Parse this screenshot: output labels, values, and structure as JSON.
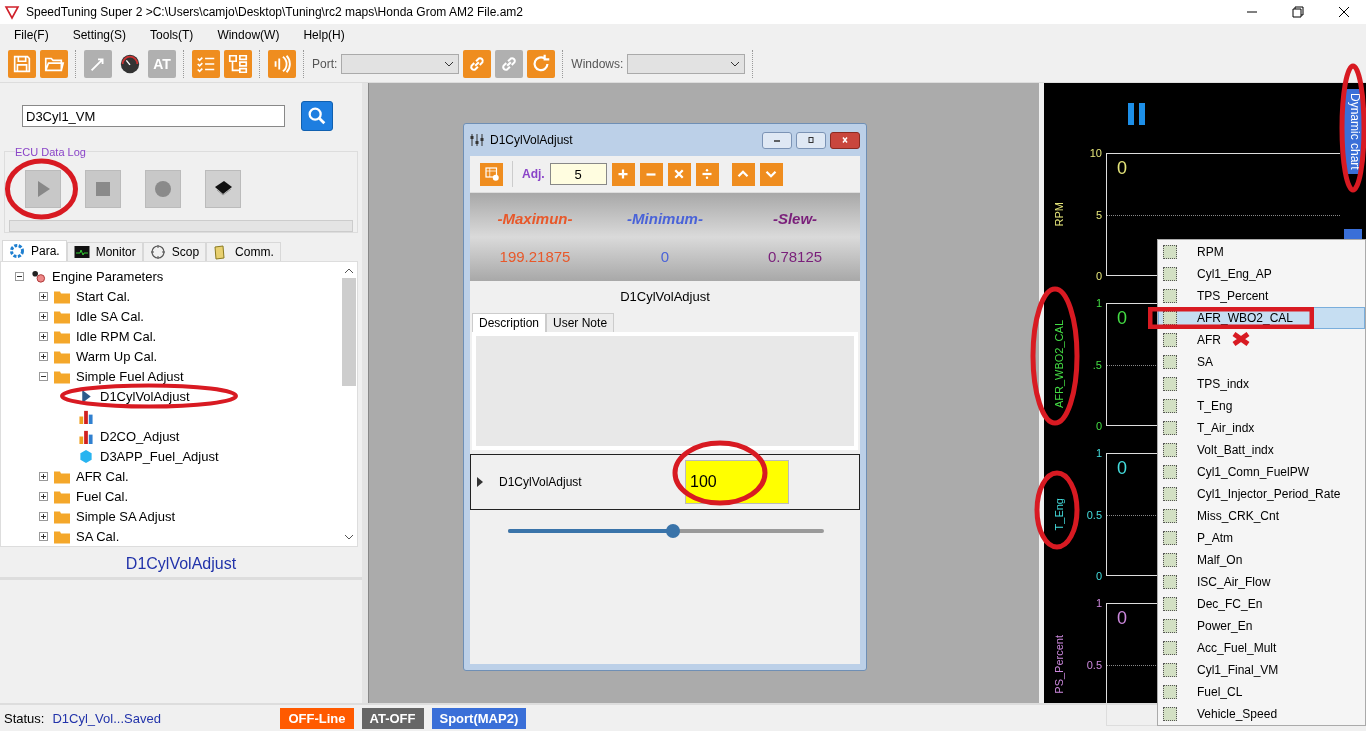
{
  "window": {
    "title": "SpeedTuning Super 2  >C:\\Users\\camjo\\Desktop\\Tuning\\rc2 maps\\Honda Grom AM2 File.am2"
  },
  "menu": [
    "File(F)",
    "Setting(S)",
    "Tools(T)",
    "Window(W)",
    "Help(H)"
  ],
  "toolbar": {
    "groups": [
      [
        {
          "kind": "save",
          "disabled": false
        },
        {
          "kind": "open",
          "disabled": false
        }
      ],
      [
        {
          "kind": "binary",
          "disabled": true
        },
        {
          "kind": "gauge",
          "disabled": false
        },
        {
          "kind": "text",
          "label": "AT",
          "disabled": true
        }
      ],
      [
        {
          "kind": "checklist",
          "disabled": false
        },
        {
          "kind": "tree",
          "disabled": false
        }
      ],
      [
        {
          "kind": "signal",
          "disabled": false
        }
      ]
    ],
    "port_label": "Port:",
    "conn": [
      {
        "kind": "link",
        "disabled": false
      },
      {
        "kind": "unlink",
        "disabled": true
      },
      {
        "kind": "refresh",
        "disabled": false
      }
    ],
    "windows_label": "Windows:"
  },
  "search": {
    "value": "D3Cyl1_VM"
  },
  "data_log": {
    "title": "ECU Data Log",
    "buttons": [
      {
        "kind": "play"
      },
      {
        "kind": "stop"
      },
      {
        "kind": "record"
      },
      {
        "kind": "chip"
      }
    ]
  },
  "tabs": [
    {
      "label": "Para.",
      "kind": "gear",
      "selected": true
    },
    {
      "label": "Monitor",
      "kind": "monitor",
      "selected": false
    },
    {
      "label": "Scop",
      "kind": "scope",
      "selected": false
    },
    {
      "label": "Comm.",
      "kind": "comm",
      "selected": false
    }
  ],
  "tree": {
    "label": "Engine Parameters",
    "expanded": true,
    "children": [
      {
        "label": "Start Cal.",
        "kind": "folder",
        "expanded": false
      },
      {
        "label": "Idle SA Cal.",
        "kind": "folder",
        "expanded": false
      },
      {
        "label": "Idle RPM Cal.",
        "kind": "folder",
        "expanded": false
      },
      {
        "label": "Warm Up Cal.",
        "kind": "folder",
        "expanded": false
      },
      {
        "label": "Simple Fuel Adjust",
        "kind": "folder",
        "expanded": true,
        "children": [
          {
            "label": "D1CylVolAdjust",
            "kind": "pointer"
          },
          {
            "kind": "bars"
          },
          {
            "label": "D2CO_Adjust",
            "kind": "bars"
          },
          {
            "label": "D3APP_Fuel_Adjust",
            "kind": "cube"
          }
        ]
      },
      {
        "label": "AFR Cal.",
        "kind": "folder",
        "expanded": false
      },
      {
        "label": "Fuel Cal.",
        "kind": "folder",
        "expanded": false
      },
      {
        "label": "Simple SA Adjust",
        "kind": "folder",
        "expanded": false
      },
      {
        "label": "SA Cal.",
        "kind": "folder",
        "expanded": false
      }
    ]
  },
  "selected_label": "D1CylVolAdjust",
  "dialog": {
    "title": "D1CylVolAdjust",
    "adj_label": "Adj.",
    "adj_value": "5",
    "ops": [
      {
        "kind": "plus"
      },
      {
        "kind": "minus"
      },
      {
        "kind": "times"
      },
      {
        "kind": "divide"
      },
      {
        "kind": "up"
      },
      {
        "kind": "down"
      }
    ],
    "stats": [
      {
        "label": "-Maximun-",
        "value": "199.21875",
        "color": "#e8582a"
      },
      {
        "label": "-Minimum-",
        "value": "0",
        "color": "#4a63d8"
      },
      {
        "label": "-Slew-",
        "value": "0.78125",
        "color": "#7a1f7a"
      }
    ],
    "param_name": "D1CylVolAdjust",
    "tabs": [
      {
        "label": "Description",
        "selected": true
      },
      {
        "label": "User Note",
        "selected": false
      }
    ],
    "row": {
      "name": "D1CylVolAdjust",
      "value": "100"
    },
    "slider": {
      "level": 0.5
    }
  },
  "chart_panels": [
    {
      "label": "RPM",
      "color": "#e6e67a",
      "ticks": [
        "10",
        "5",
        "0"
      ],
      "value": "0"
    },
    {
      "label": "AFR_WBO2_CAL",
      "color": "#44dd44",
      "ticks": [
        "1",
        ".5",
        "0"
      ],
      "value": "0"
    },
    {
      "label": "T_Eng",
      "color": "#44dddd",
      "ticks": [
        "1",
        "0.5",
        "0"
      ],
      "value": "0"
    },
    {
      "label": "PS_Percent",
      "color": "#cc88dd",
      "ticks": [
        "1",
        "0.5"
      ],
      "value": "0"
    }
  ],
  "side_tab": "Dynamic chart",
  "context_menu": [
    {
      "label": "RPM",
      "checked": false,
      "selected": false
    },
    {
      "label": "Cyl1_Eng_AP",
      "checked": false,
      "selected": false
    },
    {
      "label": "TPS_Percent",
      "checked": false,
      "selected": false
    },
    {
      "label": "AFR_WBO2_CAL",
      "checked": false,
      "selected": true
    },
    {
      "label": "AFR",
      "checked": false,
      "selected": false
    },
    {
      "label": "SA",
      "checked": false,
      "selected": false
    },
    {
      "label": "TPS_indx",
      "checked": false,
      "selected": false
    },
    {
      "label": "T_Eng",
      "checked": false,
      "selected": false
    },
    {
      "label": "T_Air_indx",
      "checked": false,
      "selected": false
    },
    {
      "label": "Volt_Batt_indx",
      "checked": false,
      "selected": false
    },
    {
      "label": "Cyl1_Comn_FuelPW",
      "checked": false,
      "selected": false
    },
    {
      "label": "Cyl1_Injector_Period_Rate",
      "checked": false,
      "selected": false
    },
    {
      "label": "Miss_CRK_Cnt",
      "checked": false,
      "selected": false
    },
    {
      "label": "P_Atm",
      "checked": false,
      "selected": false
    },
    {
      "label": "Malf_On",
      "checked": false,
      "selected": false
    },
    {
      "label": "ISC_Air_Flow",
      "checked": false,
      "selected": false
    },
    {
      "label": "Dec_FC_En",
      "checked": false,
      "selected": false
    },
    {
      "label": "Power_En",
      "checked": false,
      "selected": false
    },
    {
      "label": "Acc_Fuel_Mult",
      "checked": false,
      "selected": false
    },
    {
      "label": "Cyl1_Final_VM",
      "checked": false,
      "selected": false
    },
    {
      "label": "Fuel_CL",
      "checked": false,
      "selected": false
    },
    {
      "label": "Vehicle_Speed",
      "checked": false,
      "selected": false
    }
  ],
  "status": {
    "label": "Status:",
    "text": "D1Cyl_Vol...Saved",
    "badges": [
      {
        "label": "OFF-Line",
        "color": "#ff5a00"
      },
      {
        "label": "AT-OFF",
        "color": "#666666"
      },
      {
        "label": "Sport(MAP2)",
        "color": "#3a6fd8"
      }
    ]
  }
}
